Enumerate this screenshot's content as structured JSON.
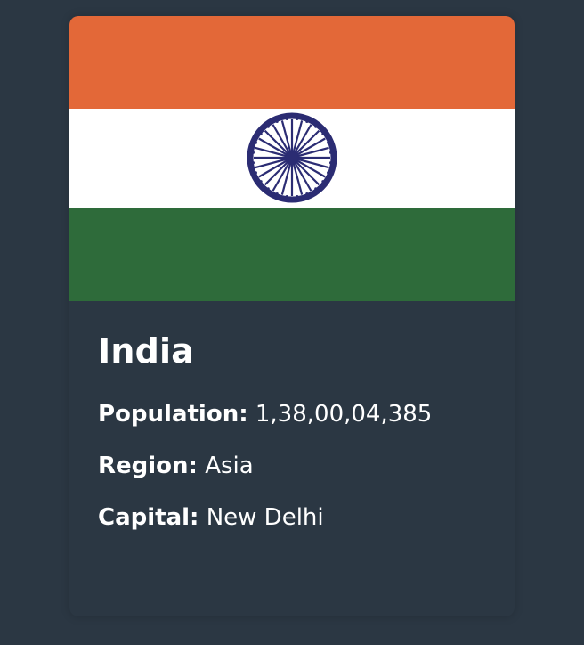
{
  "card": {
    "flag": {
      "colors": {
        "saffron": "#e36838",
        "white": "#ffffff",
        "green": "#2e6b3a",
        "chakra": "#2b2c73"
      }
    },
    "country_name": "India",
    "details": [
      {
        "label": "Population:",
        "value": "1,38,00,04,385"
      },
      {
        "label": "Region:",
        "value": "Asia"
      },
      {
        "label": "Capital:",
        "value": "New Delhi"
      }
    ]
  }
}
